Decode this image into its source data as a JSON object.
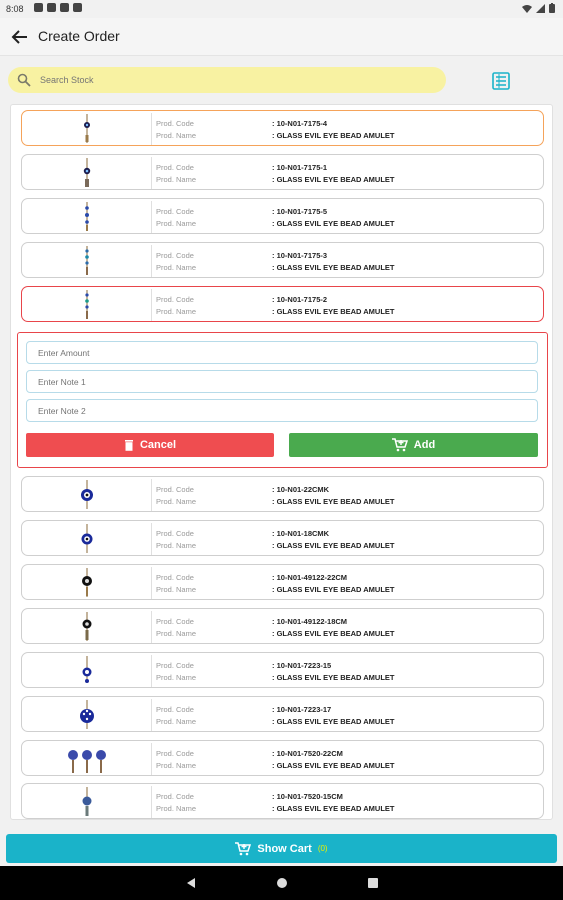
{
  "status": {
    "time": "8:08"
  },
  "header": {
    "title": "Create Order"
  },
  "search": {
    "placeholder": "Search Stock"
  },
  "labels": {
    "code": "Prod. Code",
    "name": "Prod. Name"
  },
  "products_top": [
    {
      "code": ": 10-N01-7175-4",
      "name": ": GLASS EVIL EYE BEAD AMULET"
    },
    {
      "code": ": 10-N01-7175-1",
      "name": ": GLASS EVIL EYE BEAD AMULET"
    },
    {
      "code": ": 10-N01-7175-5",
      "name": ": GLASS EVIL EYE BEAD AMULET"
    },
    {
      "code": ": 10-N01-7175-3",
      "name": ": GLASS EVIL EYE BEAD AMULET"
    },
    {
      "code": ": 10-N01-7175-2",
      "name": ": GLASS EVIL EYE BEAD AMULET"
    }
  ],
  "form": {
    "amount_placeholder": "Enter Amount",
    "note1_placeholder": "Enter Note 1",
    "note2_placeholder": "Enter Note 2",
    "cancel_label": "Cancel",
    "add_label": "Add"
  },
  "products_bottom": [
    {
      "code": ": 10-N01-22CMK",
      "name": ": GLASS EVIL EYE BEAD AMULET"
    },
    {
      "code": ": 10-N01-18CMK",
      "name": ": GLASS EVIL EYE BEAD AMULET"
    },
    {
      "code": ": 10-N01-49122-22CM",
      "name": ": GLASS EVIL EYE BEAD AMULET"
    },
    {
      "code": ": 10-N01-49122-18CM",
      "name": ": GLASS EVIL EYE BEAD AMULET"
    },
    {
      "code": ": 10-N01-7223-15",
      "name": ": GLASS EVIL EYE BEAD AMULET"
    },
    {
      "code": ": 10-N01-7223-17",
      "name": ": GLASS EVIL EYE BEAD AMULET"
    },
    {
      "code": ": 10-N01-7520-22CM",
      "name": ": GLASS EVIL EYE BEAD AMULET"
    },
    {
      "code": ": 10-N01-7520-15CM",
      "name": ": GLASS EVIL EYE BEAD AMULET"
    }
  ],
  "cart": {
    "label": "Show Cart",
    "count": "(0)"
  },
  "colors": {
    "accent": "#1ab3c9",
    "search_bg": "#f8f2a2",
    "cancel": "#ef4d50",
    "add": "#4aaa4e",
    "selected_border": "#e8454a"
  }
}
